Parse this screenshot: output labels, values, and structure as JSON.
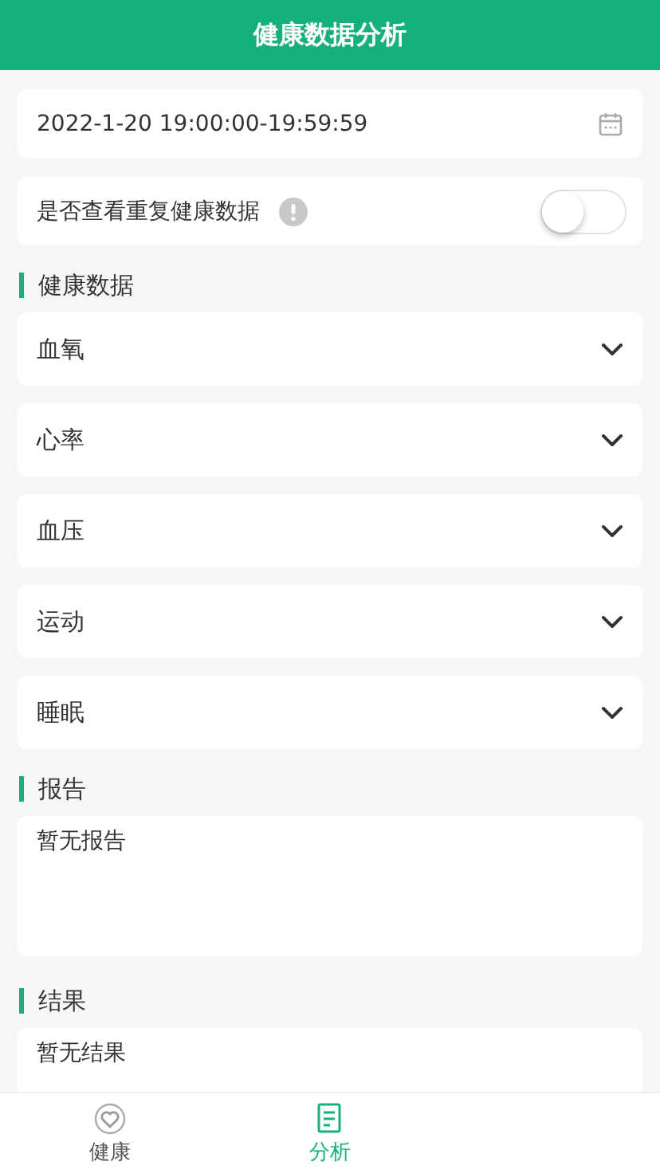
{
  "header": {
    "title": "健康数据分析"
  },
  "date_field": {
    "value": "2022-1-20 19:00:00-19:59:59"
  },
  "repeat_toggle": {
    "label": "是否查看重复健康数据",
    "on": false
  },
  "sections": [
    {
      "kind": "accordion",
      "title": "健康数据",
      "items": [
        {
          "label": "血氧",
          "expanded": false
        },
        {
          "label": "心率",
          "expanded": false
        },
        {
          "label": "血压",
          "expanded": false
        },
        {
          "label": "运动",
          "expanded": false
        },
        {
          "label": "睡眠",
          "expanded": false
        }
      ]
    },
    {
      "kind": "text",
      "title": "报告",
      "text": "暂无报告"
    },
    {
      "kind": "text",
      "title": "结果",
      "text": "暂无结果"
    }
  ],
  "tabs": [
    {
      "label": "健康",
      "selected": false
    },
    {
      "label": "分析",
      "selected": true
    }
  ]
}
